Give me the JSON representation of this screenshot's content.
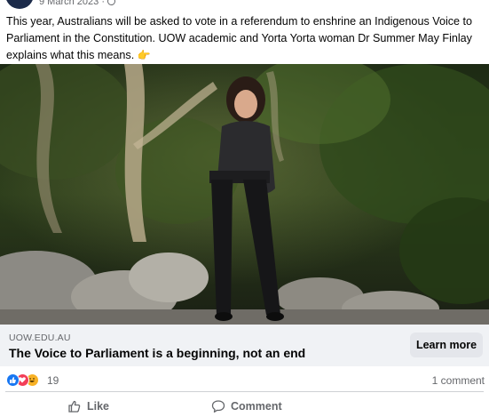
{
  "post": {
    "date": "9 March 2023 ·",
    "text": "This year, Australians will be asked to vote in a referendum to enshrine an Indigenous Voice to Parliament in the Constitution. UOW academic and Yorta Yorta woman Dr Summer May Finlay explains what this means.",
    "text_emoji": "👉"
  },
  "link_card": {
    "domain": "UOW.EDU.AU",
    "title": "The Voice to Parliament is a beginning, not an end",
    "button_label": "Learn more"
  },
  "engagement": {
    "reaction_count": "19",
    "comment_count": "1 comment",
    "reactions": [
      "like-icon",
      "love-icon",
      "haha-icon"
    ]
  },
  "actions": {
    "like_label": "Like",
    "comment_label": "Comment"
  },
  "colors": {
    "accent": "#1877f2",
    "secondary_text": "#65676b",
    "card_bg": "#f0f2f5"
  }
}
